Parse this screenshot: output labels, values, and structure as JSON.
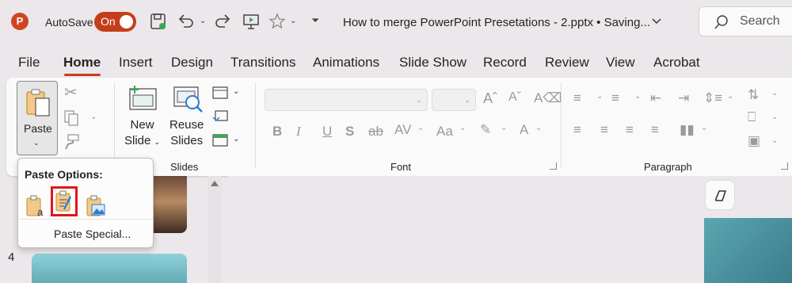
{
  "titlebar": {
    "app_icon": "P",
    "autosave_label": "AutoSave",
    "autosave_state": "On",
    "document_title": "How to merge PowerPoint Presetations - 2.pptx • Saving...",
    "search_placeholder": "Search"
  },
  "tabs": [
    "File",
    "Home",
    "Insert",
    "Design",
    "Transitions",
    "Animations",
    "Slide Show",
    "Record",
    "Review",
    "View",
    "Acrobat"
  ],
  "active_tab": "Home",
  "ribbon": {
    "paste_label": "Paste",
    "new_slide_line1": "New",
    "new_slide_line2": "Slide",
    "reuse_line1": "Reuse",
    "reuse_line2": "Slides",
    "slides_group": "Slides",
    "font_group": "Font",
    "paragraph_group": "Paragraph"
  },
  "paste_menu": {
    "title": "Paste Options:",
    "special_label": "Paste Special..."
  },
  "thumbnails": {
    "slide_number": "4"
  },
  "colors": {
    "accent": "#c43e1c",
    "highlight": "#e0161a"
  }
}
